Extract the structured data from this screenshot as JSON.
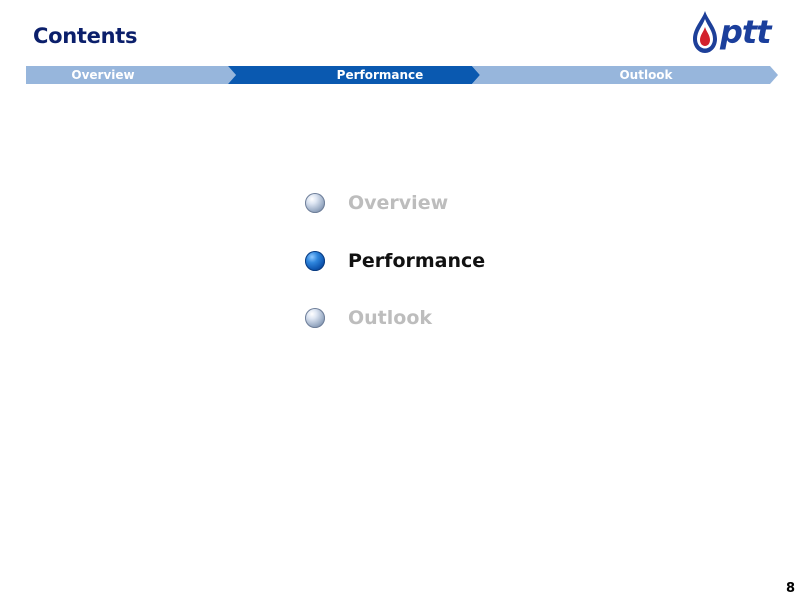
{
  "page": {
    "title": "Contents",
    "number": "8"
  },
  "logo": {
    "text": "ptt",
    "icon": "ptt-flame-icon"
  },
  "nav": {
    "tabs": [
      {
        "label": "Overview",
        "active": false
      },
      {
        "label": "Performance",
        "active": true
      },
      {
        "label": "Outlook",
        "active": false
      }
    ]
  },
  "agenda": {
    "items": [
      {
        "label": "Overview",
        "active": false
      },
      {
        "label": "Performance",
        "active": true
      },
      {
        "label": "Outlook",
        "active": false
      }
    ]
  },
  "colors": {
    "title": "#0b1f6b",
    "nav_inactive": "#97b6dc",
    "nav_active": "#0a59b0",
    "agenda_inactive": "#bdbdbd",
    "agenda_active": "#111111"
  }
}
